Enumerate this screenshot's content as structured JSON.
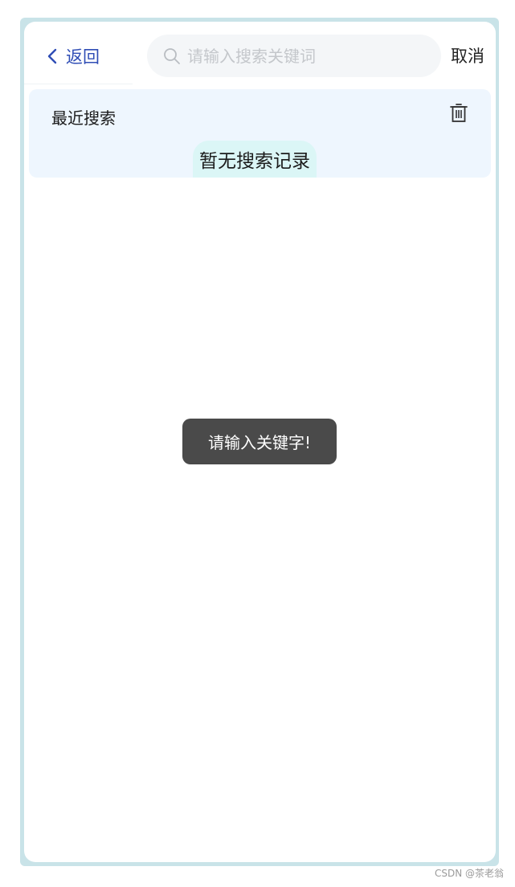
{
  "header": {
    "back_label": "返回",
    "back_icon": "chevron-left-icon",
    "search_placeholder": "请输入搜索关键词",
    "search_value": "",
    "search_icon": "search-icon",
    "cancel_label": "取消"
  },
  "recent": {
    "title": "最近搜索",
    "clear_icon": "trash-icon",
    "empty_text": "暂无搜索记录"
  },
  "toast": {
    "message": "请输入关键字!"
  },
  "watermark": "CSDN @茶老翁",
  "colors": {
    "accent": "#2f4db5",
    "panel_bg": "#eef6fe",
    "pill_bg": "#dbf6f6",
    "toast_bg": "#4a4a4a",
    "frame": "#c9e3e8"
  }
}
